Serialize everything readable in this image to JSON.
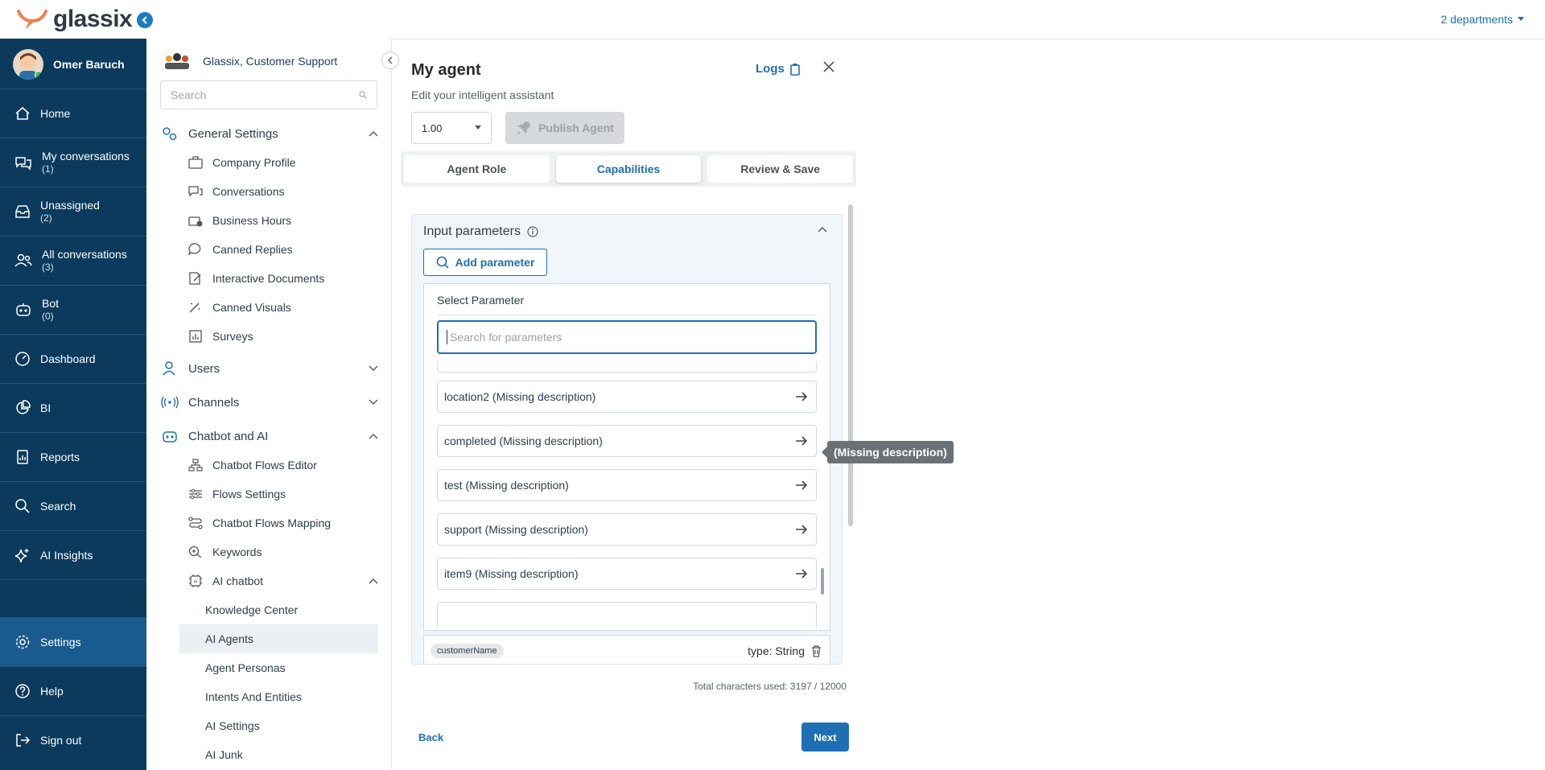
{
  "app": {
    "name": "glassix"
  },
  "user": {
    "name": "Omer Baruch"
  },
  "nav": {
    "items": [
      {
        "label": "Home",
        "count": ""
      },
      {
        "label": "My conversations",
        "count": "(1)"
      },
      {
        "label": "Unassigned",
        "count": "(2)"
      },
      {
        "label": "All conversations",
        "count": "(3)"
      },
      {
        "label": "Bot",
        "count": "(0)"
      },
      {
        "label": "Dashboard",
        "count": ""
      },
      {
        "label": "BI",
        "count": ""
      },
      {
        "label": "Reports",
        "count": ""
      },
      {
        "label": "Search",
        "count": ""
      },
      {
        "label": "AI Insights",
        "count": ""
      }
    ],
    "bottom": [
      {
        "label": "Settings"
      },
      {
        "label": "Help"
      },
      {
        "label": "Sign out"
      }
    ]
  },
  "topbar": {
    "departments": "2 departments"
  },
  "sidebar": {
    "org": "Glassix, Customer Support",
    "search_placeholder": "Search",
    "general": "General Settings",
    "general_items": [
      "Company Profile",
      "Conversations",
      "Business Hours",
      "Canned Replies",
      "Interactive Documents",
      "Canned Visuals",
      "Surveys"
    ],
    "users": "Users",
    "channels": "Channels",
    "chatbot": "Chatbot and AI",
    "chatbot_items": [
      "Chatbot Flows Editor",
      "Flows Settings",
      "Chatbot Flows Mapping",
      "Keywords"
    ],
    "ai_chatbot": "AI chatbot",
    "ai_items": [
      "Knowledge Center",
      "AI Agents",
      "Agent Personas",
      "Intents And Entities",
      "AI Settings",
      "AI Junk"
    ]
  },
  "agent": {
    "title": "My agent",
    "subtitle": "Edit your intelligent assistant",
    "logs": "Logs",
    "version": "1.00",
    "publish": "Publish Agent",
    "tabs": [
      "Agent Role",
      "Capabilities",
      "Review & Save"
    ],
    "active_tab": "Capabilities",
    "input_params": "Input parameters",
    "add_param": "Add parameter",
    "select_param": "Select Parameter",
    "search_placeholder": "Search for parameters",
    "params": [
      "location2 (Missing description)",
      "completed (Missing description)",
      "test (Missing description)",
      "support (Missing description)",
      "item9 (Missing description)"
    ],
    "tooltip": "(Missing description)",
    "selected_param": {
      "name": "customerName",
      "type": "type: String"
    },
    "total": "Total characters used: 3197 / 12000",
    "back": "Back",
    "next": "Next"
  },
  "colors": {
    "nav_bg": "#0b3a5d",
    "accent": "#1e6fb4",
    "active_nav": "#1a5b8f"
  }
}
